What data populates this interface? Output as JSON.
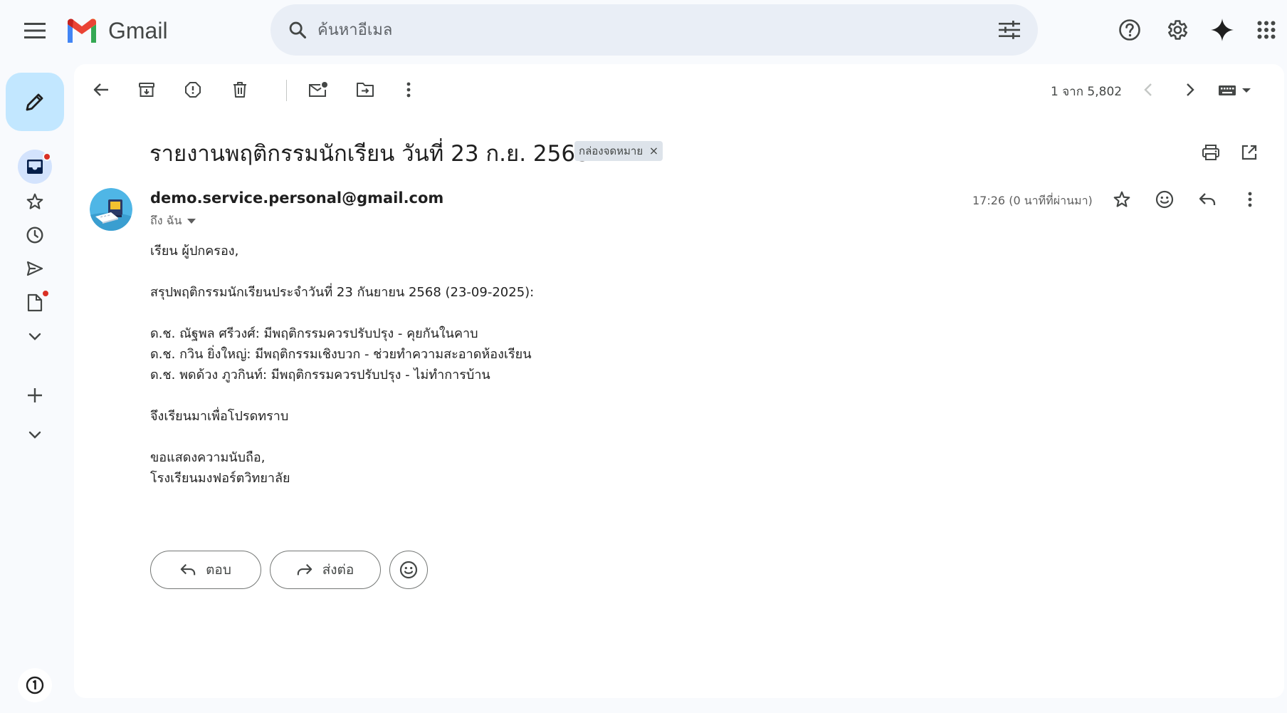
{
  "header": {
    "app_name": "Gmail",
    "search_placeholder": "ค้นหาอีเมล"
  },
  "icons": {
    "menu": "menu-icon",
    "search": "search-icon",
    "filter": "tune-icon",
    "help": "help-icon",
    "settings": "gear-icon",
    "gemini": "sparkle-icon",
    "apps": "apps-grid-icon"
  },
  "colors": {
    "accent": "#0b57d0",
    "compose_bg": "#c2e7ff",
    "active_nav": "#d3e3fd",
    "notification_dot": "#d93025",
    "label_chip_bg": "#dde3ea"
  },
  "toolbar": {
    "pager_text": "1 จาก 5,802"
  },
  "email": {
    "subject": "รายงานพฤติกรรมนักเรียน วันที่ 23 ก.ย. 2568",
    "label": "กล่องจดหมาย",
    "label_remove": "×",
    "sender": "demo.service.personal@gmail.com",
    "recipient": "ถึง ฉัน",
    "timestamp": "17:26 (0 นาทีที่ผ่านมา)",
    "body": {
      "greeting": "เรียน ผู้ปกครอง,",
      "summary": "สรุปพฤติกรรมนักเรียนประจำวันที่ 23 กันยายน 2568 (23-09-2025):",
      "students": [
        "ด.ช. ณัฐพล ศรีวงศ์: มีพฤติกรรมควรปรับปรุง - คุยกันในคาบ",
        "ด.ช. กวิน ยิ่งใหญ่: มีพฤติกรรมเชิงบวก - ช่วยทำความสะอาดห้องเรียน",
        "ด.ช. พดด้วง ภูวกินท์: มีพฤติกรรมควรปรับปรุง - ไม่ทำการบ้าน"
      ],
      "closing": "จึงเรียนมาเพื่อโปรดทราบ",
      "regards": "ขอแสดงความนับถือ,",
      "signature": "โรงเรียนมงฟอร์ตวิทยาลัย"
    }
  },
  "actions": {
    "reply": "ตอบ",
    "forward": "ส่งต่อ"
  }
}
